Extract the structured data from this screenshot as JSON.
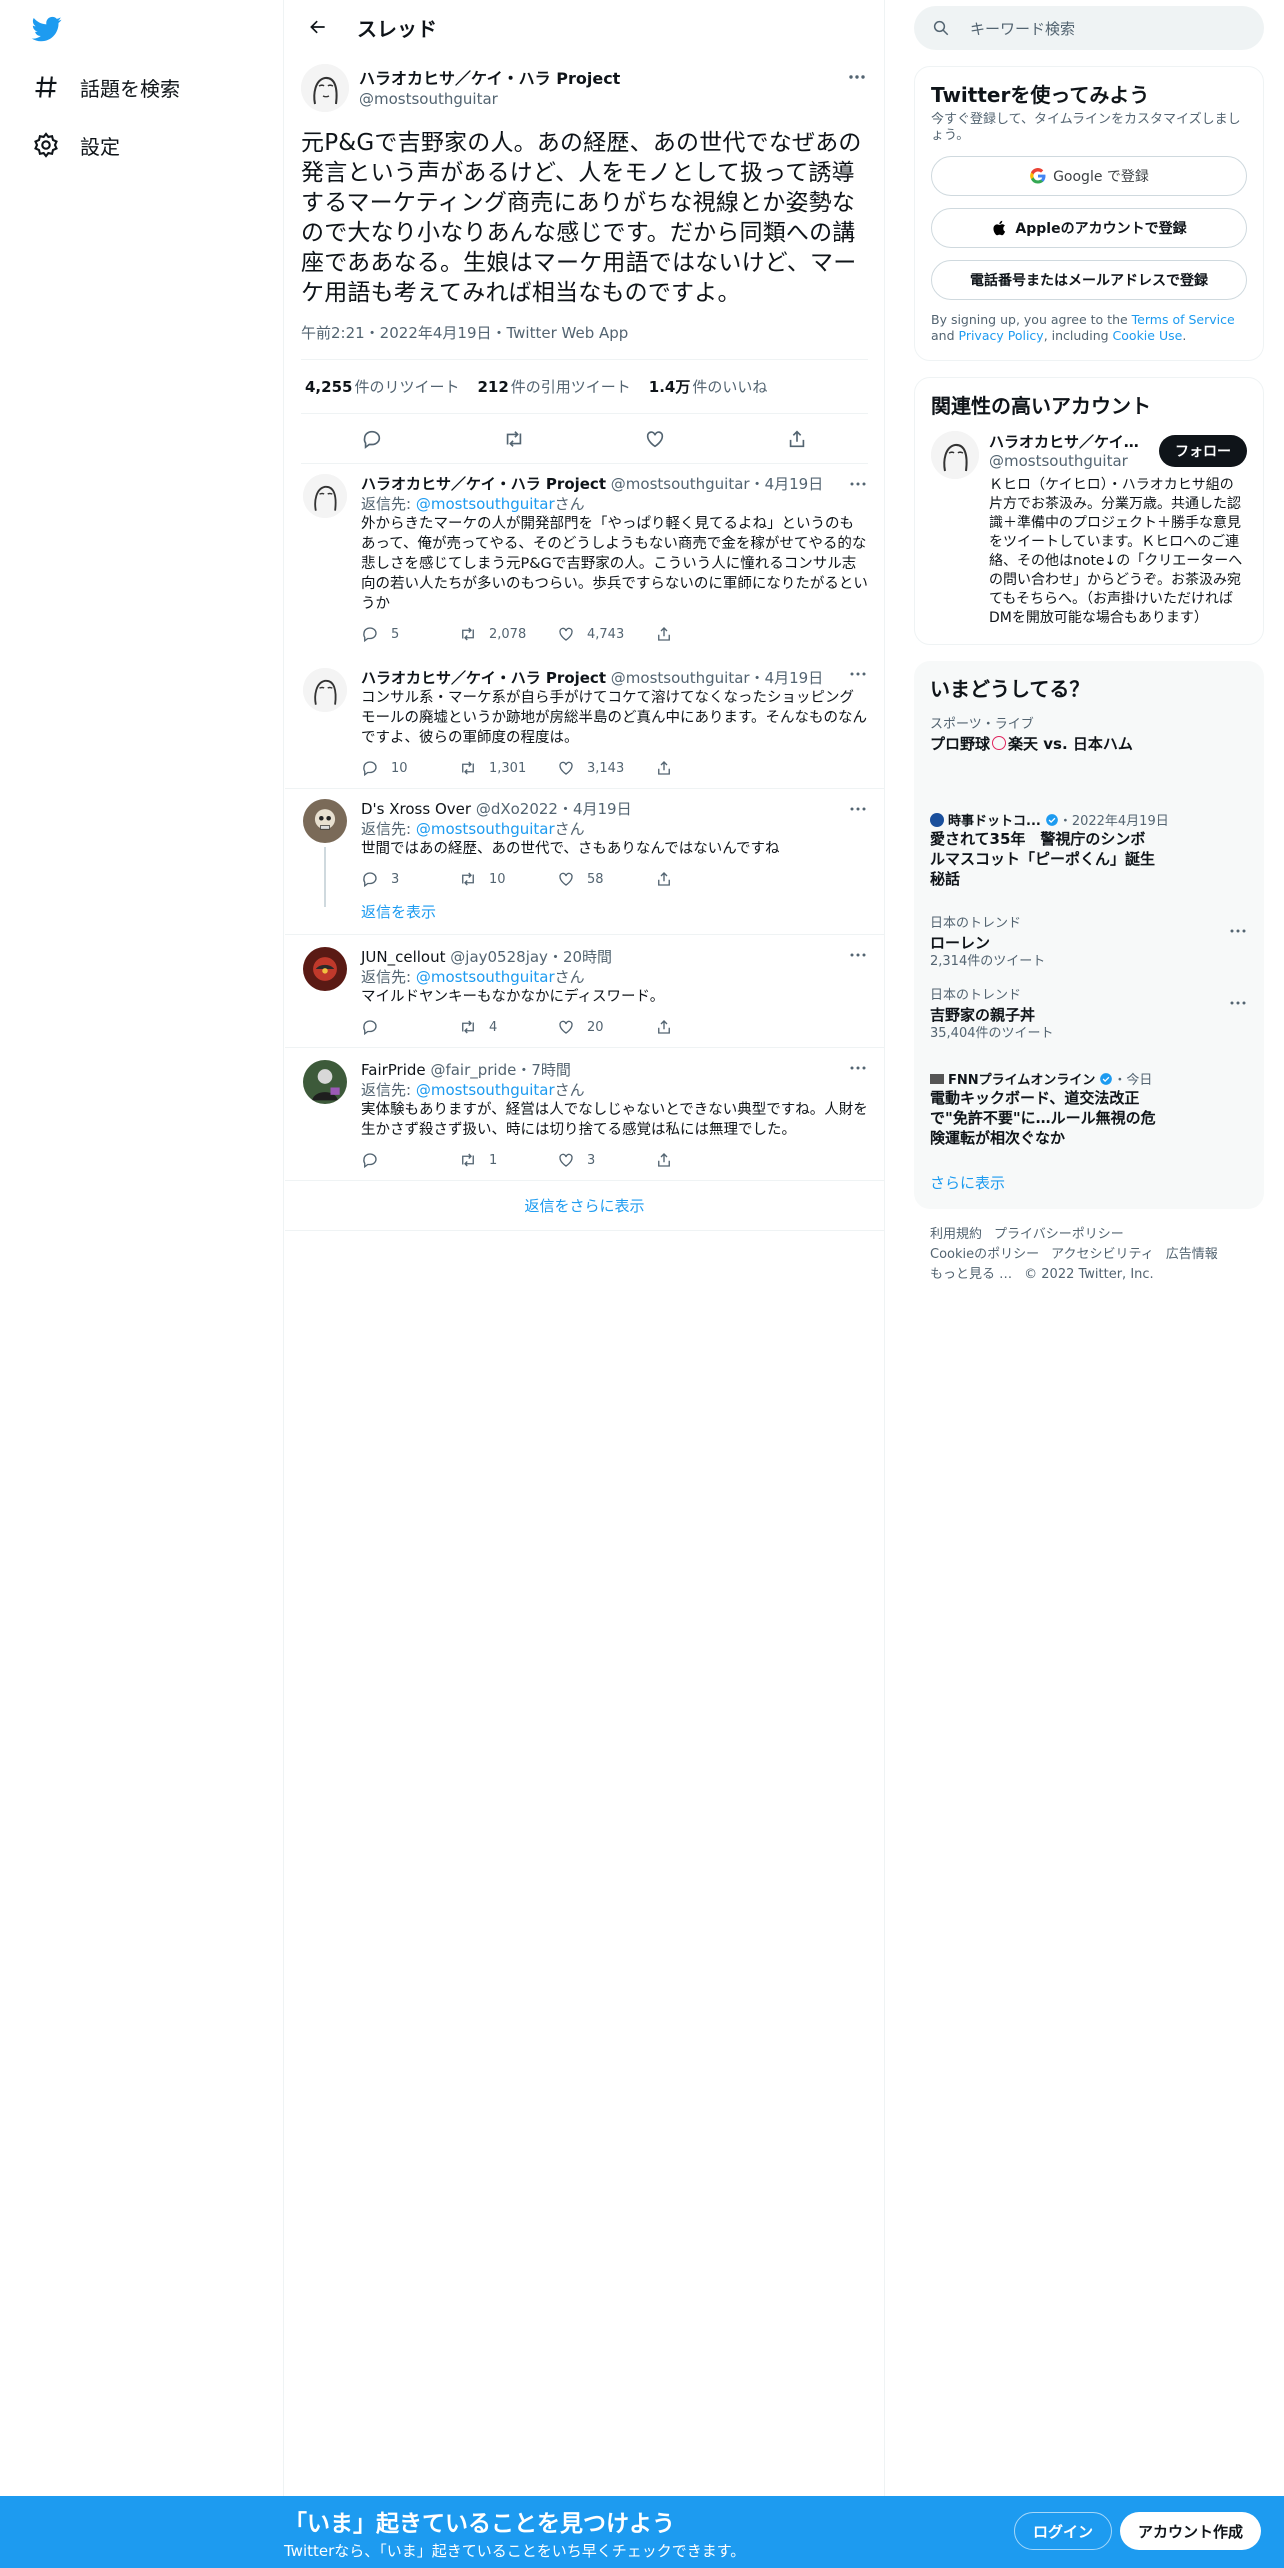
{
  "nav": {
    "explore": "話題を検索",
    "settings": "設定"
  },
  "header": {
    "title": "スレッド"
  },
  "focal": {
    "name": "ハラオカヒサ／ケイ・ハラ Project",
    "handle": "@mostsouthguitar",
    "text": "元P&Gで吉野家の人。あの経歴、あの世代でなぜあの発言という声があるけど、人をモノとして扱って誘導するマーケティング商売にありがちな視線とか姿勢なので大なり小なりあんな感じです。だから同類への講座でああなる。生娘はマーケ用語ではないけど、マーケ用語も考えてみれば相当なものですよ。",
    "meta": "午前2:21・2022年4月19日・Twitter Web App",
    "stats": {
      "retweets_count": "4,255",
      "retweets_label": "件のリツイート",
      "quotes_count": "212",
      "quotes_label": "件の引用ツイート",
      "likes_count": "1.4万",
      "likes_label": "件のいいね"
    }
  },
  "replies": [
    {
      "name": "ハラオカヒサ／ケイ・ハラ Project",
      "handle": "@mostsouthguitar",
      "time": "・4月19日",
      "reply_prefix": "返信先: ",
      "reply_to": "@mostsouthguitar",
      "reply_suffix": "さん",
      "text": "外からきたマーケの人が開発部門を「やっぱり軽く見てるよね」というのもあって、俺が売ってやる、そのどうしようもない商売で金を稼がせてやる的な悲しさを感じてしまう元P&Gで吉野家の人。こういう人に憧れるコンサル志向の若い人たちが多いのもつらい。歩兵ですらないのに軍師になりたがるというか",
      "replies": "5",
      "retweets": "2,078",
      "likes": "4,743"
    },
    {
      "name": "ハラオカヒサ／ケイ・ハラ Project",
      "handle": "@mostsouthguitar",
      "time": "・4月19日",
      "text": "コンサル系・マーケ系が自ら手がけてコケて溶けてなくなったショッピングモールの廃墟というか跡地が房総半島のど真ん中にあります。そんなものなんですよ、彼らの軍師度の程度は。",
      "replies": "10",
      "retweets": "1,301",
      "likes": "3,143"
    },
    {
      "name": "D's Xross Over",
      "handle": "@dXo2022",
      "time": "・4月19日",
      "reply_prefix": "返信先: ",
      "reply_to": "@mostsouthguitar",
      "reply_suffix": "さん",
      "text": "世間ではあの経歴、あの世代で、さもありなんではないんですね",
      "replies": "3",
      "retweets": "10",
      "likes": "58",
      "show_replies": "返信を表示"
    },
    {
      "name": "JUN_cellout",
      "handle": "@jay0528jay",
      "time": "・20時間",
      "reply_prefix": "返信先: ",
      "reply_to": "@mostsouthguitar",
      "reply_suffix": "さん",
      "text": "マイルドヤンキーもなかなかにディスワード。",
      "replies": "",
      "retweets": "4",
      "likes": "20"
    },
    {
      "name": "FairPride",
      "handle": "@fair_pride",
      "time": "・7時間",
      "reply_prefix": "返信先: ",
      "reply_to": "@mostsouthguitar",
      "reply_suffix": "さん",
      "text": "実体験もありますが、経営は人でなしじゃないとできない典型ですね。人財を生かさず殺さず扱い、時には切り捨てる感覚は私には無理でした。",
      "replies": "",
      "retweets": "1",
      "likes": "3"
    }
  ],
  "more_replies": "返信をさらに表示",
  "right": {
    "search_placeholder": "キーワード検索",
    "signup": {
      "title": "Twitterを使ってみよう",
      "subtitle": "今すぐ登録して、タイムラインをカスタマイズしましょう。",
      "google": "Google で登録",
      "apple": "Appleのアカウントで登録",
      "phone": "電話番号またはメールアドレスで登録",
      "terms_1": "By signing up, you agree to the ",
      "terms_link1": "Terms of Service",
      "terms_2": " and ",
      "terms_link2": "Privacy Policy",
      "terms_3": ", including ",
      "terms_link3": "Cookie Use",
      "terms_4": "."
    },
    "relevant": {
      "title": "関連性の高いアカウント",
      "name": "ハラオカヒサ／ケイ・ハラ Project",
      "handle": "@mostsouthguitar",
      "follow": "フォロー",
      "bio": "Ｋヒロ（ケイヒロ）・ハラオカヒサ組の片方でお茶汲み。分業万歳。共通した認識＋準備中のプロジェクト＋勝手な意見をツイートしています。Ｋヒロへのご連絡、その他はnote↓の「クリエーターへの問い合わせ」からどうぞ。お茶汲み宛てもそちらへ。（お声掛けいただければDMを開放可能な場合もあります）"
    },
    "trends": {
      "title": "いまどうしてる？",
      "items": [
        {
          "category": "スポーツ・ライブ",
          "title_a": "プロ野球",
          "title_b": "楽天 vs. 日本ハム"
        },
        {
          "source": "時事ドットコ...",
          "time": "・2022年4月19日",
          "title": "愛されて35年　警視庁のシンボルマスコット「ピーポくん」誕生秘話"
        },
        {
          "category": "日本のトレンド",
          "title": "ローレン",
          "count": "2,314件のツイート"
        },
        {
          "category": "日本のトレンド",
          "title": "吉野家の親子丼",
          "count": "35,404件のツイート"
        },
        {
          "source": "FNNプライムオンライン",
          "time": "・今日",
          "title": "電動キックボード、道交法改正で\"免許不要\"に…ルール無視の危険運転が相次ぐなか"
        }
      ],
      "show_more": "さらに表示"
    },
    "footer": {
      "terms": "利用規約",
      "privacy": "プライバシーポリシー",
      "cookie": "Cookieのポリシー",
      "accessibility": "アクセシビリティ",
      "ads": "広告情報",
      "more": "もっと見る …",
      "copyright": "© 2022 Twitter, Inc."
    }
  },
  "bottombar": {
    "title": "「いま」起きていることを見つけよう",
    "subtitle": "Twitterなら、「いま」起きていることをいち早くチェックできます。",
    "login": "ログイン",
    "signup": "アカウント作成"
  },
  "colors": {
    "accent": "#1d9bf0",
    "text": "#0f1419",
    "muted": "#536471",
    "card": "#f7f9f9"
  }
}
